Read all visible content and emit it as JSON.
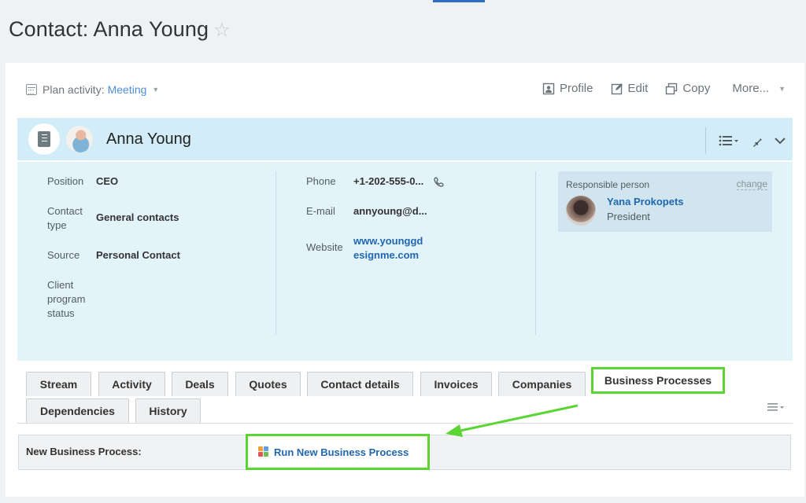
{
  "page": {
    "title": "Contact: Anna Young",
    "star_glyph": "☆"
  },
  "toolbar": {
    "plan_label": "Plan activity:",
    "plan_value": "Meeting",
    "actions": [
      "Profile",
      "Edit",
      "Copy",
      "More..."
    ]
  },
  "contact": {
    "name": "Anna Young"
  },
  "details": {
    "position_label": "Position",
    "position_value": "CEO",
    "contact_type_label": "Contact type",
    "contact_type_value": "General contacts",
    "source_label": "Source",
    "source_value": "Personal Contact",
    "client_program_label": "Client program status",
    "phone_label": "Phone",
    "phone_value": "+1-202-555-0...",
    "email_label": "E-mail",
    "email_value": "annyoung@d...",
    "website_label": "Website",
    "website_value": "www.younggd esignme.com"
  },
  "responsible": {
    "label": "Responsible person",
    "change": "change",
    "name": "Yana Prokopets",
    "position": "President"
  },
  "tabs": [
    {
      "label": "Stream"
    },
    {
      "label": "Activity"
    },
    {
      "label": "Deals"
    },
    {
      "label": "Quotes"
    },
    {
      "label": "Contact details"
    },
    {
      "label": "Invoices"
    },
    {
      "label": "Companies"
    },
    {
      "label": "Business Processes"
    },
    {
      "label": "Dependencies"
    },
    {
      "label": "History"
    }
  ],
  "business_process": {
    "label": "New Business Process:",
    "run_label": "Run New Business Process"
  },
  "colors": {
    "highlight": "#5ad532",
    "link": "#2067b0",
    "header_bg": "#d3edf8",
    "details_bg": "#e3f3fa"
  }
}
